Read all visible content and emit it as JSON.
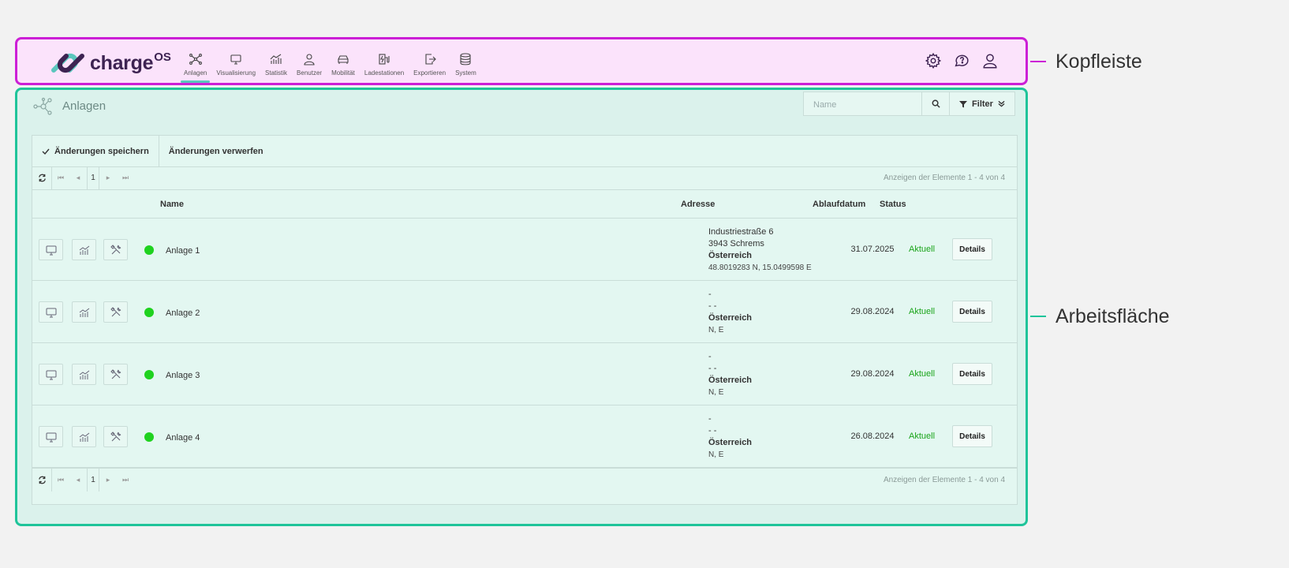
{
  "logo": {
    "text": "charge",
    "sup": "OS"
  },
  "nav": [
    {
      "label": "Anlagen",
      "icon": "network-icon",
      "active": true
    },
    {
      "label": "Visualisierung",
      "icon": "monitor-icon"
    },
    {
      "label": "Statistik",
      "icon": "chart-icon"
    },
    {
      "label": "Benutzer",
      "icon": "user-icon"
    },
    {
      "label": "Mobilität",
      "icon": "car-icon"
    },
    {
      "label": "Ladestationen",
      "icon": "charger-icon"
    },
    {
      "label": "Exportieren",
      "icon": "export-icon"
    },
    {
      "label": "System",
      "icon": "database-icon"
    }
  ],
  "callouts": {
    "header": "Kopfleiste",
    "work": "Arbeitsfläche"
  },
  "page": {
    "title": "Anlagen"
  },
  "search": {
    "placeholder": "Name"
  },
  "filter": {
    "label": "Filter"
  },
  "toolbar": {
    "save": "Änderungen speichern",
    "discard": "Änderungen verwerfen"
  },
  "pager": {
    "page": "1",
    "info": "Anzeigen der Elemente 1 - 4 von 4"
  },
  "columns": {
    "name": "Name",
    "address": "Adresse",
    "expiry": "Ablaufdatum",
    "status": "Status"
  },
  "rows": [
    {
      "name": "Anlage 1",
      "street": "Industriestraße 6",
      "city": "3943 Schrems",
      "country": "Österreich",
      "coord": "48.8019283 N, 15.0499598 E",
      "date": "31.07.2025",
      "status": "Aktuell",
      "details": "Details"
    },
    {
      "name": "Anlage 2",
      "street": "-",
      "city": "- -",
      "country": "Österreich",
      "coord": "N, E",
      "date": "29.08.2024",
      "status": "Aktuell",
      "details": "Details"
    },
    {
      "name": "Anlage 3",
      "street": "-",
      "city": "- -",
      "country": "Österreich",
      "coord": "N, E",
      "date": "29.08.2024",
      "status": "Aktuell",
      "details": "Details"
    },
    {
      "name": "Anlage 4",
      "street": "-",
      "city": "- -",
      "country": "Österreich",
      "coord": "N, E",
      "date": "26.08.2024",
      "status": "Aktuell",
      "details": "Details"
    }
  ],
  "colors": {
    "header_border": "#cc1fd6",
    "work_border": "#1fc49a",
    "accent": "#5bc6bd",
    "status_ok": "#1aa41a",
    "dot": "#1fd21f"
  }
}
